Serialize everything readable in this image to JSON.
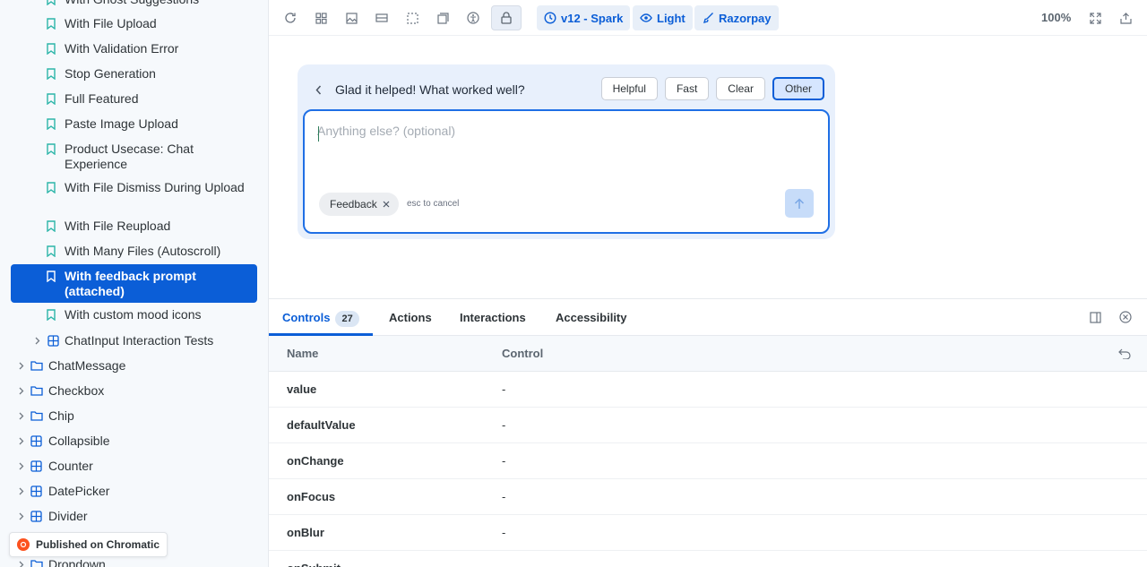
{
  "sidebar": {
    "stories": [
      {
        "label": "With Ghost Suggestions"
      },
      {
        "label": "With File Upload"
      },
      {
        "label": "With Validation Error"
      },
      {
        "label": "Stop Generation"
      },
      {
        "label": "Full Featured"
      },
      {
        "label": "Paste Image Upload"
      },
      {
        "label": "Product Usecase: Chat Experience"
      },
      {
        "label": "With File Dismiss During Upload"
      },
      {
        "label": "With File Reupload"
      },
      {
        "label": "With Many Files (Autoscroll)"
      },
      {
        "label": "With feedback prompt (attached)"
      },
      {
        "label": "With custom mood icons"
      }
    ],
    "nodes": [
      {
        "label": "ChatInput Interaction Tests"
      },
      {
        "label": "ChatMessage"
      },
      {
        "label": "Checkbox"
      },
      {
        "label": "Chip"
      },
      {
        "label": "Collapsible"
      },
      {
        "label": "Counter"
      },
      {
        "label": "DatePicker"
      },
      {
        "label": "Divider"
      },
      {
        "label": "Dropdown"
      }
    ],
    "chromatic_label": "Published on Chromatic"
  },
  "toolbar": {
    "theme_version": "v12 - Spark",
    "color_scheme": "Light",
    "brand": "Razorpay",
    "zoom": "100%"
  },
  "feedback": {
    "question": "Glad it helped! What worked well?",
    "chips": [
      "Helpful",
      "Fast",
      "Clear",
      "Other"
    ],
    "selected_chip": "Other",
    "placeholder": "Anything else? (optional)",
    "tag": "Feedback",
    "hint": "esc to cancel"
  },
  "panel": {
    "tabs": {
      "controls": "Controls",
      "controls_count": "27",
      "actions": "Actions",
      "interactions": "Interactions",
      "accessibility": "Accessibility"
    },
    "headers": {
      "name": "Name",
      "control": "Control"
    },
    "rows": [
      {
        "name": "value",
        "control": "-"
      },
      {
        "name": "defaultValue",
        "control": "-"
      },
      {
        "name": "onChange",
        "control": "-"
      },
      {
        "name": "onFocus",
        "control": "-"
      },
      {
        "name": "onBlur",
        "control": "-"
      },
      {
        "name": "onSubmit",
        "control": ""
      }
    ]
  },
  "colors": {
    "accent": "#0b5ed7",
    "story_icon": "#2bb5a8"
  }
}
